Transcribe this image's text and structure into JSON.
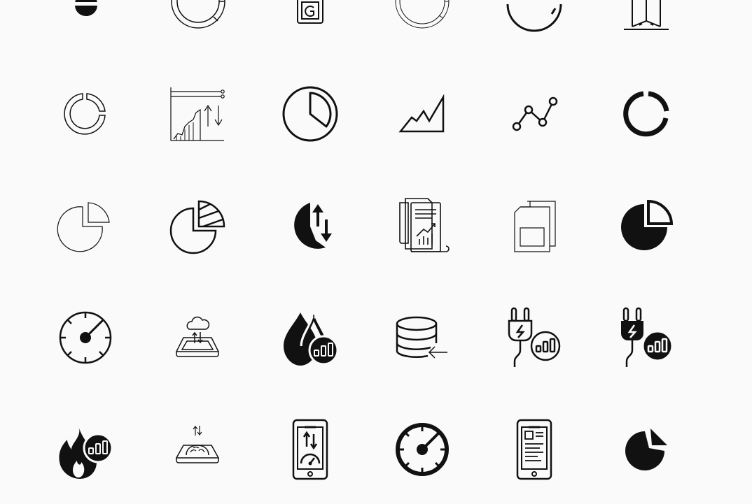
{
  "gallery": {
    "ink_color": "#111111",
    "background_color": "#fafafa",
    "rows": [
      [
        "data-drop-icon",
        "donut-chart-outline-icon",
        "mobile-report-icon",
        "donut-chart-thin-icon",
        "gauge-arc-icon",
        "database-tower-icon"
      ],
      [
        "donut-chart-small-icon",
        "financial-growth-chart-icon",
        "pie-chart-slice-icon",
        "area-chart-icon",
        "line-graph-nodes-icon",
        "donut-chart-bold-icon"
      ],
      [
        "pie-chart-thin-icon",
        "pie-chart-striped-slice-icon",
        "pie-chart-transfer-icon",
        "financial-report-documents-icon",
        "sim-card-icon",
        "pie-chart-filled-icon"
      ],
      [
        "speedometer-icon",
        "cloud-tablet-transfer-icon",
        "water-drops-stats-icon",
        "database-import-icon",
        "plug-stats-outline-icon",
        "plug-stats-filled-icon"
      ],
      [
        "fire-stats-icon",
        "tablet-brain-transfer-icon",
        "mobile-speed-transfer-icon",
        "speedometer-bold-icon",
        "mobile-document-icon",
        "pie-chart-exploded-icon"
      ]
    ]
  }
}
